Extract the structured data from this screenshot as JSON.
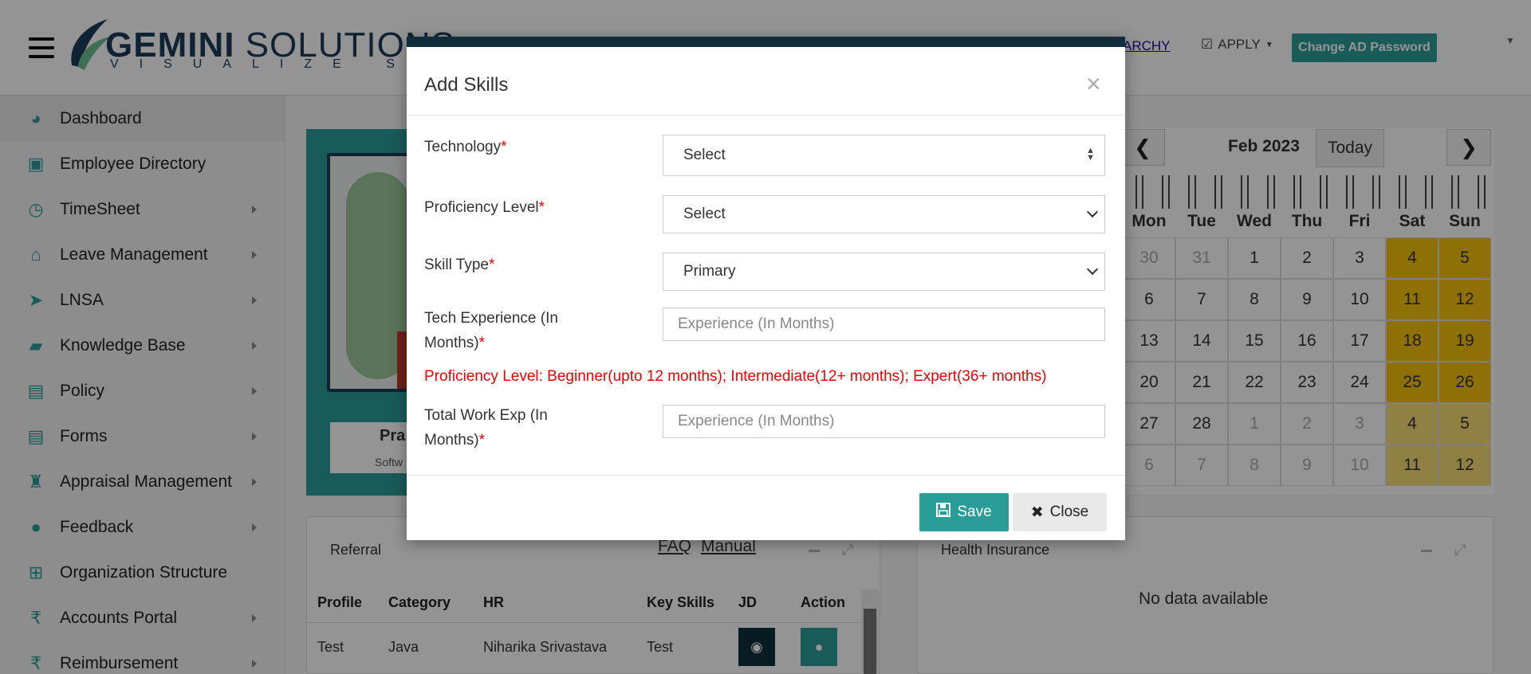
{
  "header": {
    "logo_main": "GEMINI",
    "logo_secondary": "SOLUTIONS",
    "logo_tagline": "VISUALIZE SUCCESS",
    "hierarchy_link": "ARCHY",
    "apply_label": "APPLY",
    "change_password_label": "Change AD Password"
  },
  "sidebar": {
    "items": [
      {
        "label": "Dashboard",
        "icon": "dashboard-icon"
      },
      {
        "label": "Employee Directory",
        "icon": "contact-card-icon"
      },
      {
        "label": "TimeSheet",
        "icon": "clock-icon"
      },
      {
        "label": "Leave Management",
        "icon": "home-icon"
      },
      {
        "label": "LNSA",
        "icon": "paper-plane-icon"
      },
      {
        "label": "Knowledge Base",
        "icon": "folder-icon"
      },
      {
        "label": "Policy",
        "icon": "document-icon"
      },
      {
        "label": "Forms",
        "icon": "document-icon"
      },
      {
        "label": "Appraisal Management",
        "icon": "graduation-cap-icon"
      },
      {
        "label": "Feedback",
        "icon": "chat-icon"
      },
      {
        "label": "Organization Structure",
        "icon": "sitemap-icon"
      },
      {
        "label": "Accounts Portal",
        "icon": "rupee-icon"
      },
      {
        "label": "Reimbursement",
        "icon": "rupee-icon"
      }
    ]
  },
  "profile": {
    "name_partial": "Pra",
    "role_partial": "Softw"
  },
  "calendar": {
    "month_label": "Feb 2023",
    "today_label": "Today",
    "prev_label": "❮",
    "next_label": "❯",
    "weekdays": [
      "Mon",
      "Tue",
      "Wed",
      "Thu",
      "Fri",
      "Sat",
      "Sun"
    ],
    "weeks": [
      [
        "30",
        "31",
        "1",
        "2",
        "3",
        "4",
        "5"
      ],
      [
        "6",
        "7",
        "8",
        "9",
        "10",
        "11",
        "12"
      ],
      [
        "13",
        "14",
        "15",
        "16",
        "17",
        "18",
        "19"
      ],
      [
        "20",
        "21",
        "22",
        "23",
        "24",
        "25",
        "26"
      ],
      [
        "27",
        "28",
        "1",
        "2",
        "3",
        "4",
        "5"
      ],
      [
        "6",
        "7",
        "8",
        "9",
        "10",
        "11",
        "12"
      ]
    ]
  },
  "referral": {
    "title": "Referral",
    "faq_link": "FAQ",
    "manual_link": "Manual",
    "columns": [
      "Profile",
      "Category",
      "HR",
      "Key Skills",
      "JD",
      "Action"
    ],
    "rows": [
      {
        "profile": "Test",
        "category": "Java",
        "hr": "Niharika Srivastava",
        "key_skills": "Test"
      }
    ]
  },
  "health_insurance": {
    "title": "Health Insurance",
    "empty_text": "No data available"
  },
  "modal": {
    "title": "Add Skills",
    "close_glyph": "×",
    "fields": {
      "technology": {
        "label": "Technology",
        "value": "Select"
      },
      "proficiency": {
        "label": "Proficiency Level",
        "value": "Select"
      },
      "skill_type": {
        "label": "Skill Type",
        "value": "Primary"
      },
      "tech_exp": {
        "label_line1": "Tech Experience (In",
        "label_line2": "Months)",
        "placeholder": "Experience (In Months)"
      },
      "total_exp": {
        "label_line1": "Total Work Exp (In",
        "label_line2": "Months)",
        "placeholder": "Experience (In Months)"
      }
    },
    "required_mark": "*",
    "info_text": "Proficiency Level: Beginner(upto 12 months); Intermediate(12+ months); Expert(36+ months)",
    "save_label": "Save",
    "close_label": "Close"
  },
  "colors": {
    "accent": "#2a9d98",
    "modal_top_bar": "#0f2d3c",
    "weekend": "#f4c20d",
    "required": "#e00000"
  }
}
